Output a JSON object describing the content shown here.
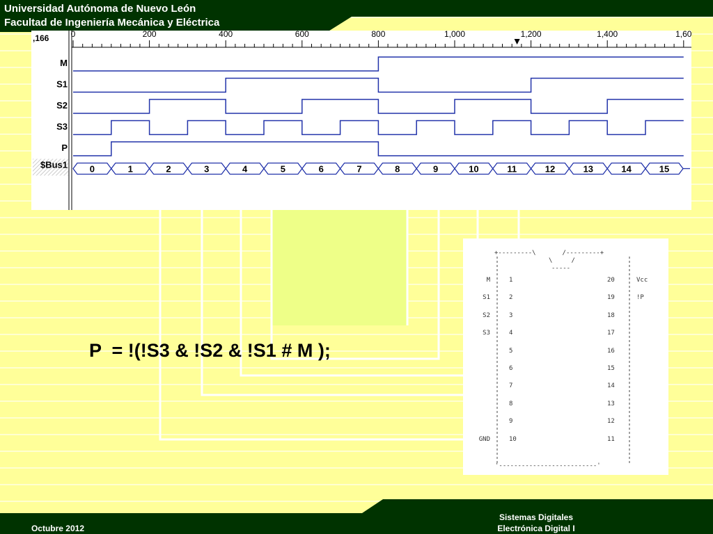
{
  "header": {
    "line1": "Universidad Autónoma de Nuevo León",
    "line2": "Facultad de Ingeniería Mecánica y Eléctrica"
  },
  "footer": {
    "date": "Octubre 2012",
    "course_line1": "Sistemas Digitales",
    "course_line2": "Electrónica Digital I"
  },
  "colors": {
    "dark_green": "#003300",
    "background": "#ffff99",
    "wave_blue": "#2233aa",
    "light_green_box": "#eeff88"
  },
  "formula": "P  = !(!S3 & !S2 & !S1 # M );",
  "waveform": {
    "cursor_label": ",166",
    "ticks": [
      "0",
      "200",
      "400",
      "600",
      "800",
      "1,000",
      "1,200",
      "1,400",
      "1,60"
    ],
    "signals": [
      {
        "name": "M",
        "levels": [
          0,
          0,
          0,
          0,
          0,
          0,
          0,
          0,
          1,
          1,
          1,
          1,
          1,
          1,
          1,
          1
        ]
      },
      {
        "name": "S1",
        "levels": [
          0,
          0,
          0,
          0,
          1,
          1,
          1,
          1,
          0,
          0,
          0,
          0,
          1,
          1,
          1,
          1
        ]
      },
      {
        "name": "S2",
        "levels": [
          0,
          0,
          1,
          1,
          0,
          0,
          1,
          1,
          0,
          0,
          1,
          1,
          0,
          0,
          1,
          1
        ]
      },
      {
        "name": "S3",
        "levels": [
          0,
          1,
          0,
          1,
          0,
          1,
          0,
          1,
          0,
          1,
          0,
          1,
          0,
          1,
          0,
          1
        ]
      },
      {
        "name": "P",
        "levels": [
          0,
          1,
          1,
          1,
          1,
          1,
          1,
          1,
          0,
          0,
          0,
          0,
          0,
          0,
          0,
          0
        ]
      }
    ],
    "bus_name": "$Bus1",
    "bus_values": [
      "0",
      "1",
      "2",
      "3",
      "4",
      "5",
      "6",
      "7",
      "8",
      "9",
      "10",
      "11",
      "12",
      "13",
      "14",
      "15"
    ]
  },
  "pinout": {
    "top_border": "+---------\\       /---------+",
    "notch_1": "\\     /",
    "notch_2": "-----",
    "bottom_border": "'--------------------------'",
    "left_pins": [
      {
        "label": "M",
        "num": "1"
      },
      {
        "label": "S1",
        "num": "2"
      },
      {
        "label": "S2",
        "num": "3"
      },
      {
        "label": "S3",
        "num": "4"
      },
      {
        "label": "",
        "num": "5"
      },
      {
        "label": "",
        "num": "6"
      },
      {
        "label": "",
        "num": "7"
      },
      {
        "label": "",
        "num": "8"
      },
      {
        "label": "",
        "num": "9"
      },
      {
        "label": "GND",
        "num": "10"
      }
    ],
    "right_pins": [
      {
        "num": "20",
        "label": "Vcc"
      },
      {
        "num": "19",
        "label": "!P"
      },
      {
        "num": "18",
        "label": ""
      },
      {
        "num": "17",
        "label": ""
      },
      {
        "num": "16",
        "label": ""
      },
      {
        "num": "15",
        "label": ""
      },
      {
        "num": "14",
        "label": ""
      },
      {
        "num": "13",
        "label": ""
      },
      {
        "num": "12",
        "label": ""
      },
      {
        "num": "11",
        "label": ""
      }
    ]
  }
}
